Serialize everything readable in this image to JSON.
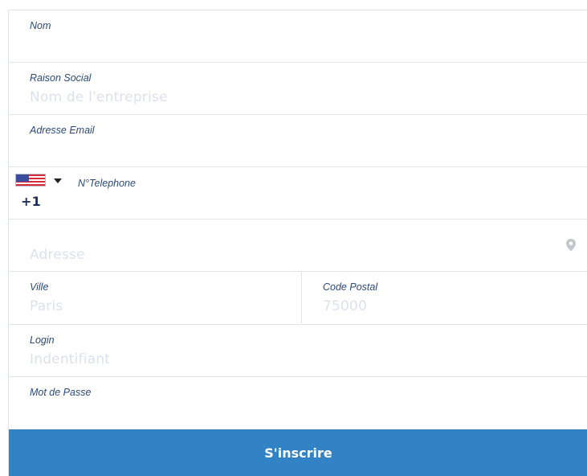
{
  "form": {
    "nom": {
      "label": "Nom",
      "value": ""
    },
    "raison_social": {
      "label": "Raison Social",
      "placeholder": "Nom de l'entreprise"
    },
    "email": {
      "label": "Adresse Email",
      "value": ""
    },
    "telephone": {
      "label": "N°Telephone",
      "value": "+1",
      "country_flag": "us-flag-icon"
    },
    "adresse": {
      "placeholder": "Adresse",
      "icon": "location-pin-icon"
    },
    "ville": {
      "label": "Ville",
      "placeholder": "Paris"
    },
    "code_postal": {
      "label": "Code Postal",
      "placeholder": "75000"
    },
    "login": {
      "label": "Login",
      "placeholder": "Indentifiant"
    },
    "mot_de_passe": {
      "label": "Mot de Passe",
      "value": ""
    },
    "submit_label": "S'inscrire"
  },
  "colors": {
    "label": "#2b4a7a",
    "placeholder": "#dde1ee",
    "divider": "#e1e4ea",
    "button": "#3283c6",
    "button_text": "#ffffff"
  }
}
